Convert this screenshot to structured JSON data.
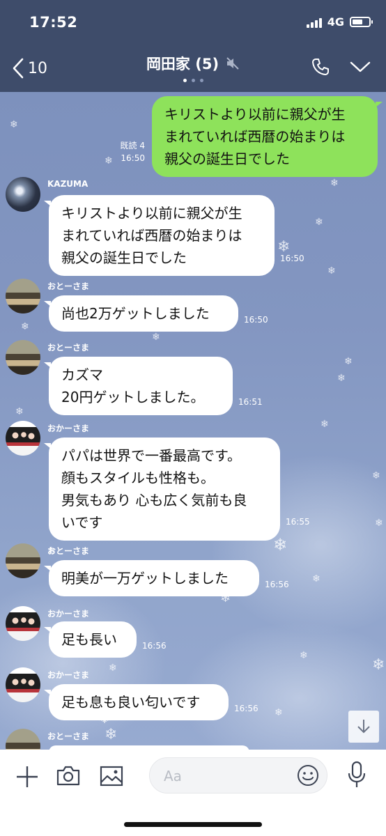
{
  "status_bar": {
    "time": "17:52",
    "network": "4G",
    "battery_level": 0.65
  },
  "header": {
    "back_count": "10",
    "title": "岡田家 (5)",
    "page_dots": {
      "count": 3,
      "active": 0
    }
  },
  "icons": {
    "back": "chevron-left-icon",
    "mute": "muted-speaker-icon",
    "call": "phone-icon",
    "menu": "chevron-down-icon",
    "scroll_down": "arrow-down-icon",
    "add": "plus-icon",
    "camera": "camera-icon",
    "image": "image-icon",
    "emoji": "smiley-icon",
    "mic": "microphone-icon"
  },
  "colors": {
    "header_bg": "#3e4c6a",
    "outgoing_bubble": "#8ee25b",
    "incoming_bubble": "#ffffff"
  },
  "messages": [
    {
      "direction": "out",
      "text": "キリストより以前に親父が生\nまれていれば西暦の始まりは\n親父の誕生日でした",
      "read": "既読 4",
      "time": "16:50"
    },
    {
      "direction": "in",
      "sender": "KAZUMA",
      "avatar": "kazuma",
      "text": "キリストより以前に親父が生\nまれていれば西暦の始まりは\n親父の誕生日でした",
      "time": "16:50"
    },
    {
      "direction": "in",
      "sender": "おとーさま",
      "avatar": "father",
      "text": "尚也2万ゲットしました",
      "time": "16:50"
    },
    {
      "direction": "in",
      "sender": "おとーさま",
      "avatar": "father",
      "text": "カズマ\n20円ゲットしました。",
      "time": "16:51"
    },
    {
      "direction": "in",
      "sender": "おかーさま",
      "avatar": "mother",
      "text": "パパは世界で一番最高です。\n顔もスタイルも性格も。\n男気もあり 心も広く気前も良\nいです",
      "time": "16:55"
    },
    {
      "direction": "in",
      "sender": "おとーさま",
      "avatar": "father",
      "text": "明美が一万ゲットしました",
      "time": "16:56"
    },
    {
      "direction": "in",
      "sender": "おかーさま",
      "avatar": "mother",
      "text": "足も長い",
      "time": "16:56"
    },
    {
      "direction": "in",
      "sender": "おかーさま",
      "avatar": "mother",
      "text": "足も息も良い匂いです",
      "time": "16:56"
    },
    {
      "direction": "in",
      "sender": "おとーさま",
      "avatar": "father",
      "text": "",
      "time": ""
    }
  ],
  "input": {
    "placeholder": "Aa"
  }
}
